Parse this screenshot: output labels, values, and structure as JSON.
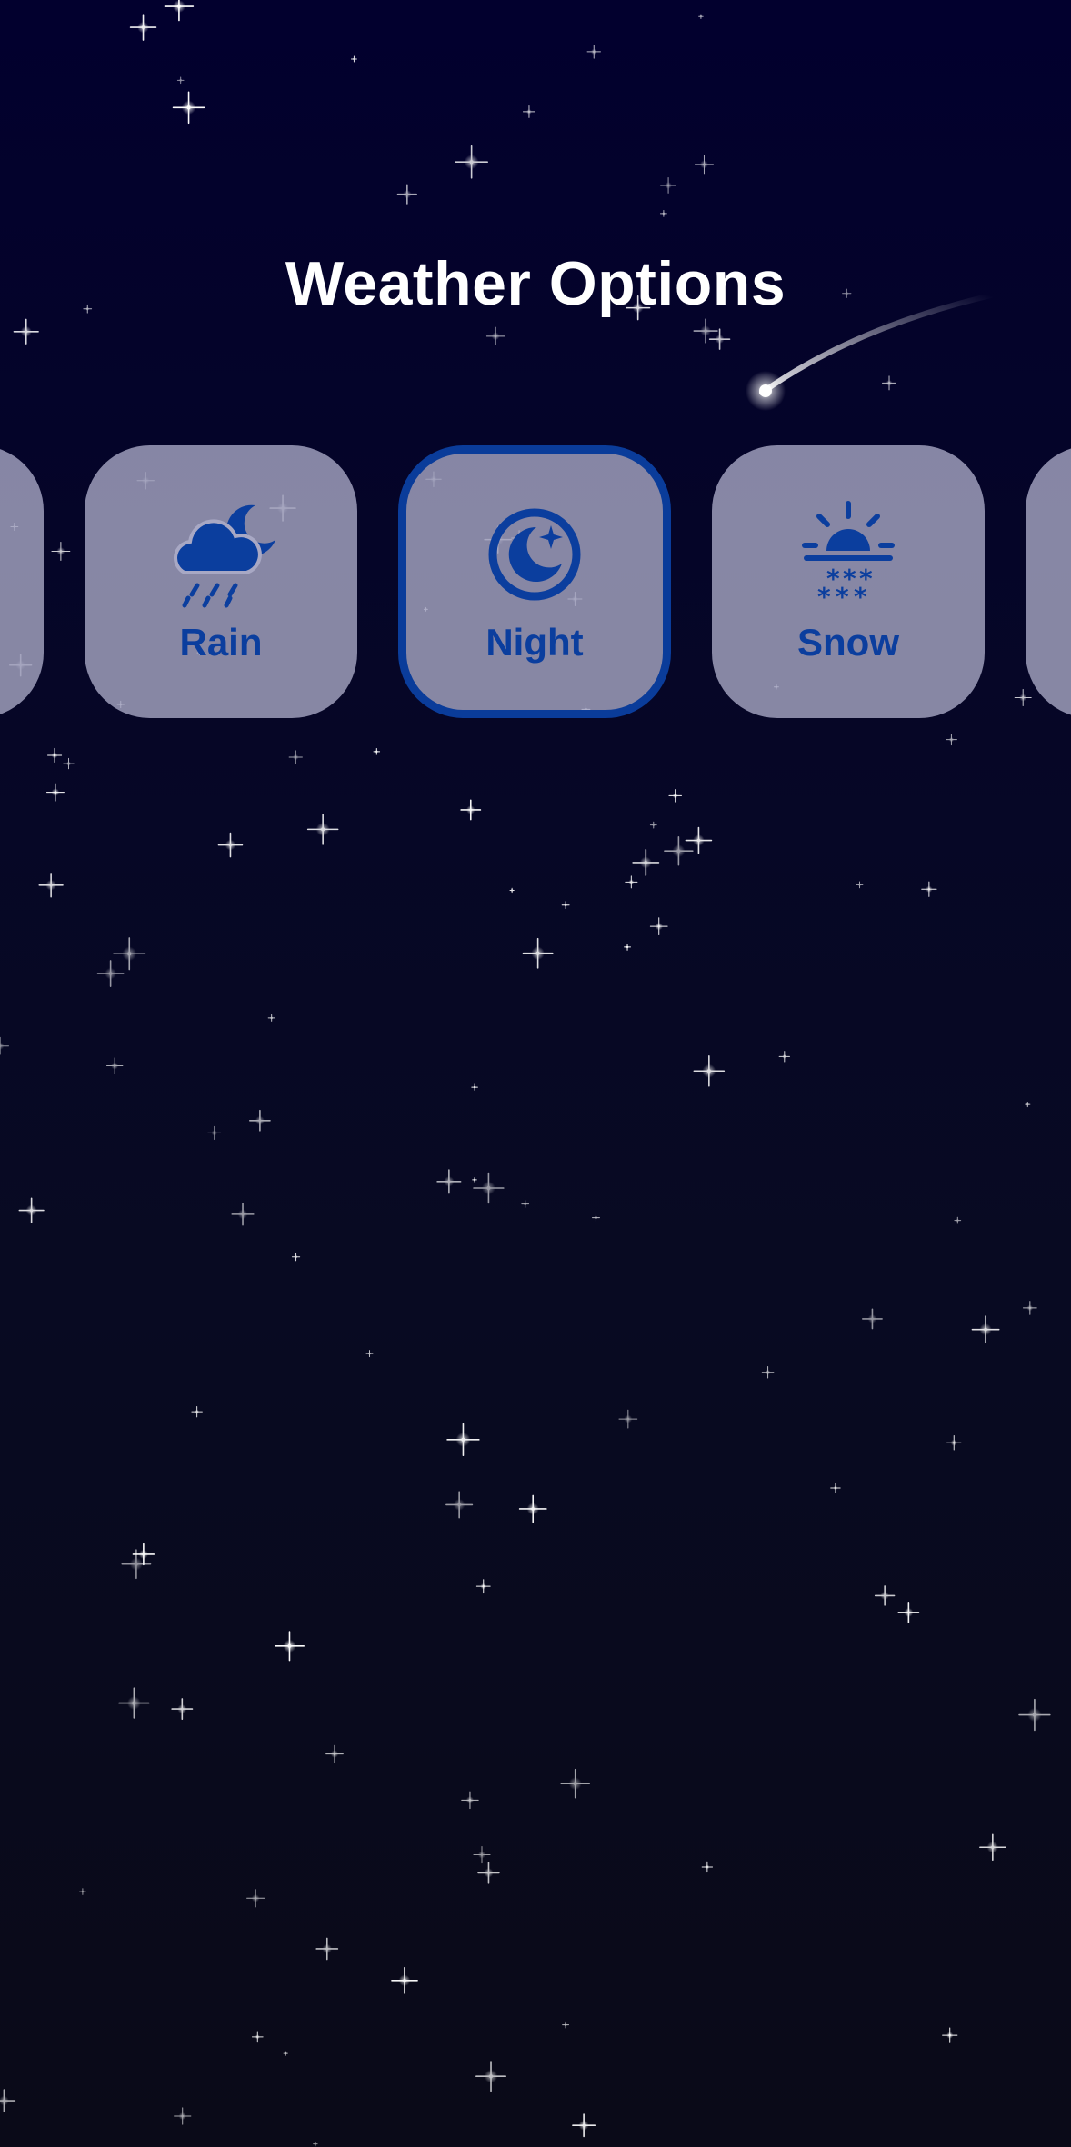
{
  "page": {
    "title": "Weather Options"
  },
  "colors": {
    "background_top": "#02002e",
    "background_bottom": "#0a0a18",
    "tile_fill": "#a8a8c4",
    "accent_blue": "#0b3e9e",
    "title_text": "#ffffff"
  },
  "options": [
    {
      "label": "Rain",
      "icon": "cloud-moon-rain-icon",
      "selected": false
    },
    {
      "label": "Night",
      "icon": "moon-stars-circle-icon",
      "selected": true
    },
    {
      "label": "Snow",
      "icon": "sunrise-snow-icon",
      "selected": false
    }
  ]
}
